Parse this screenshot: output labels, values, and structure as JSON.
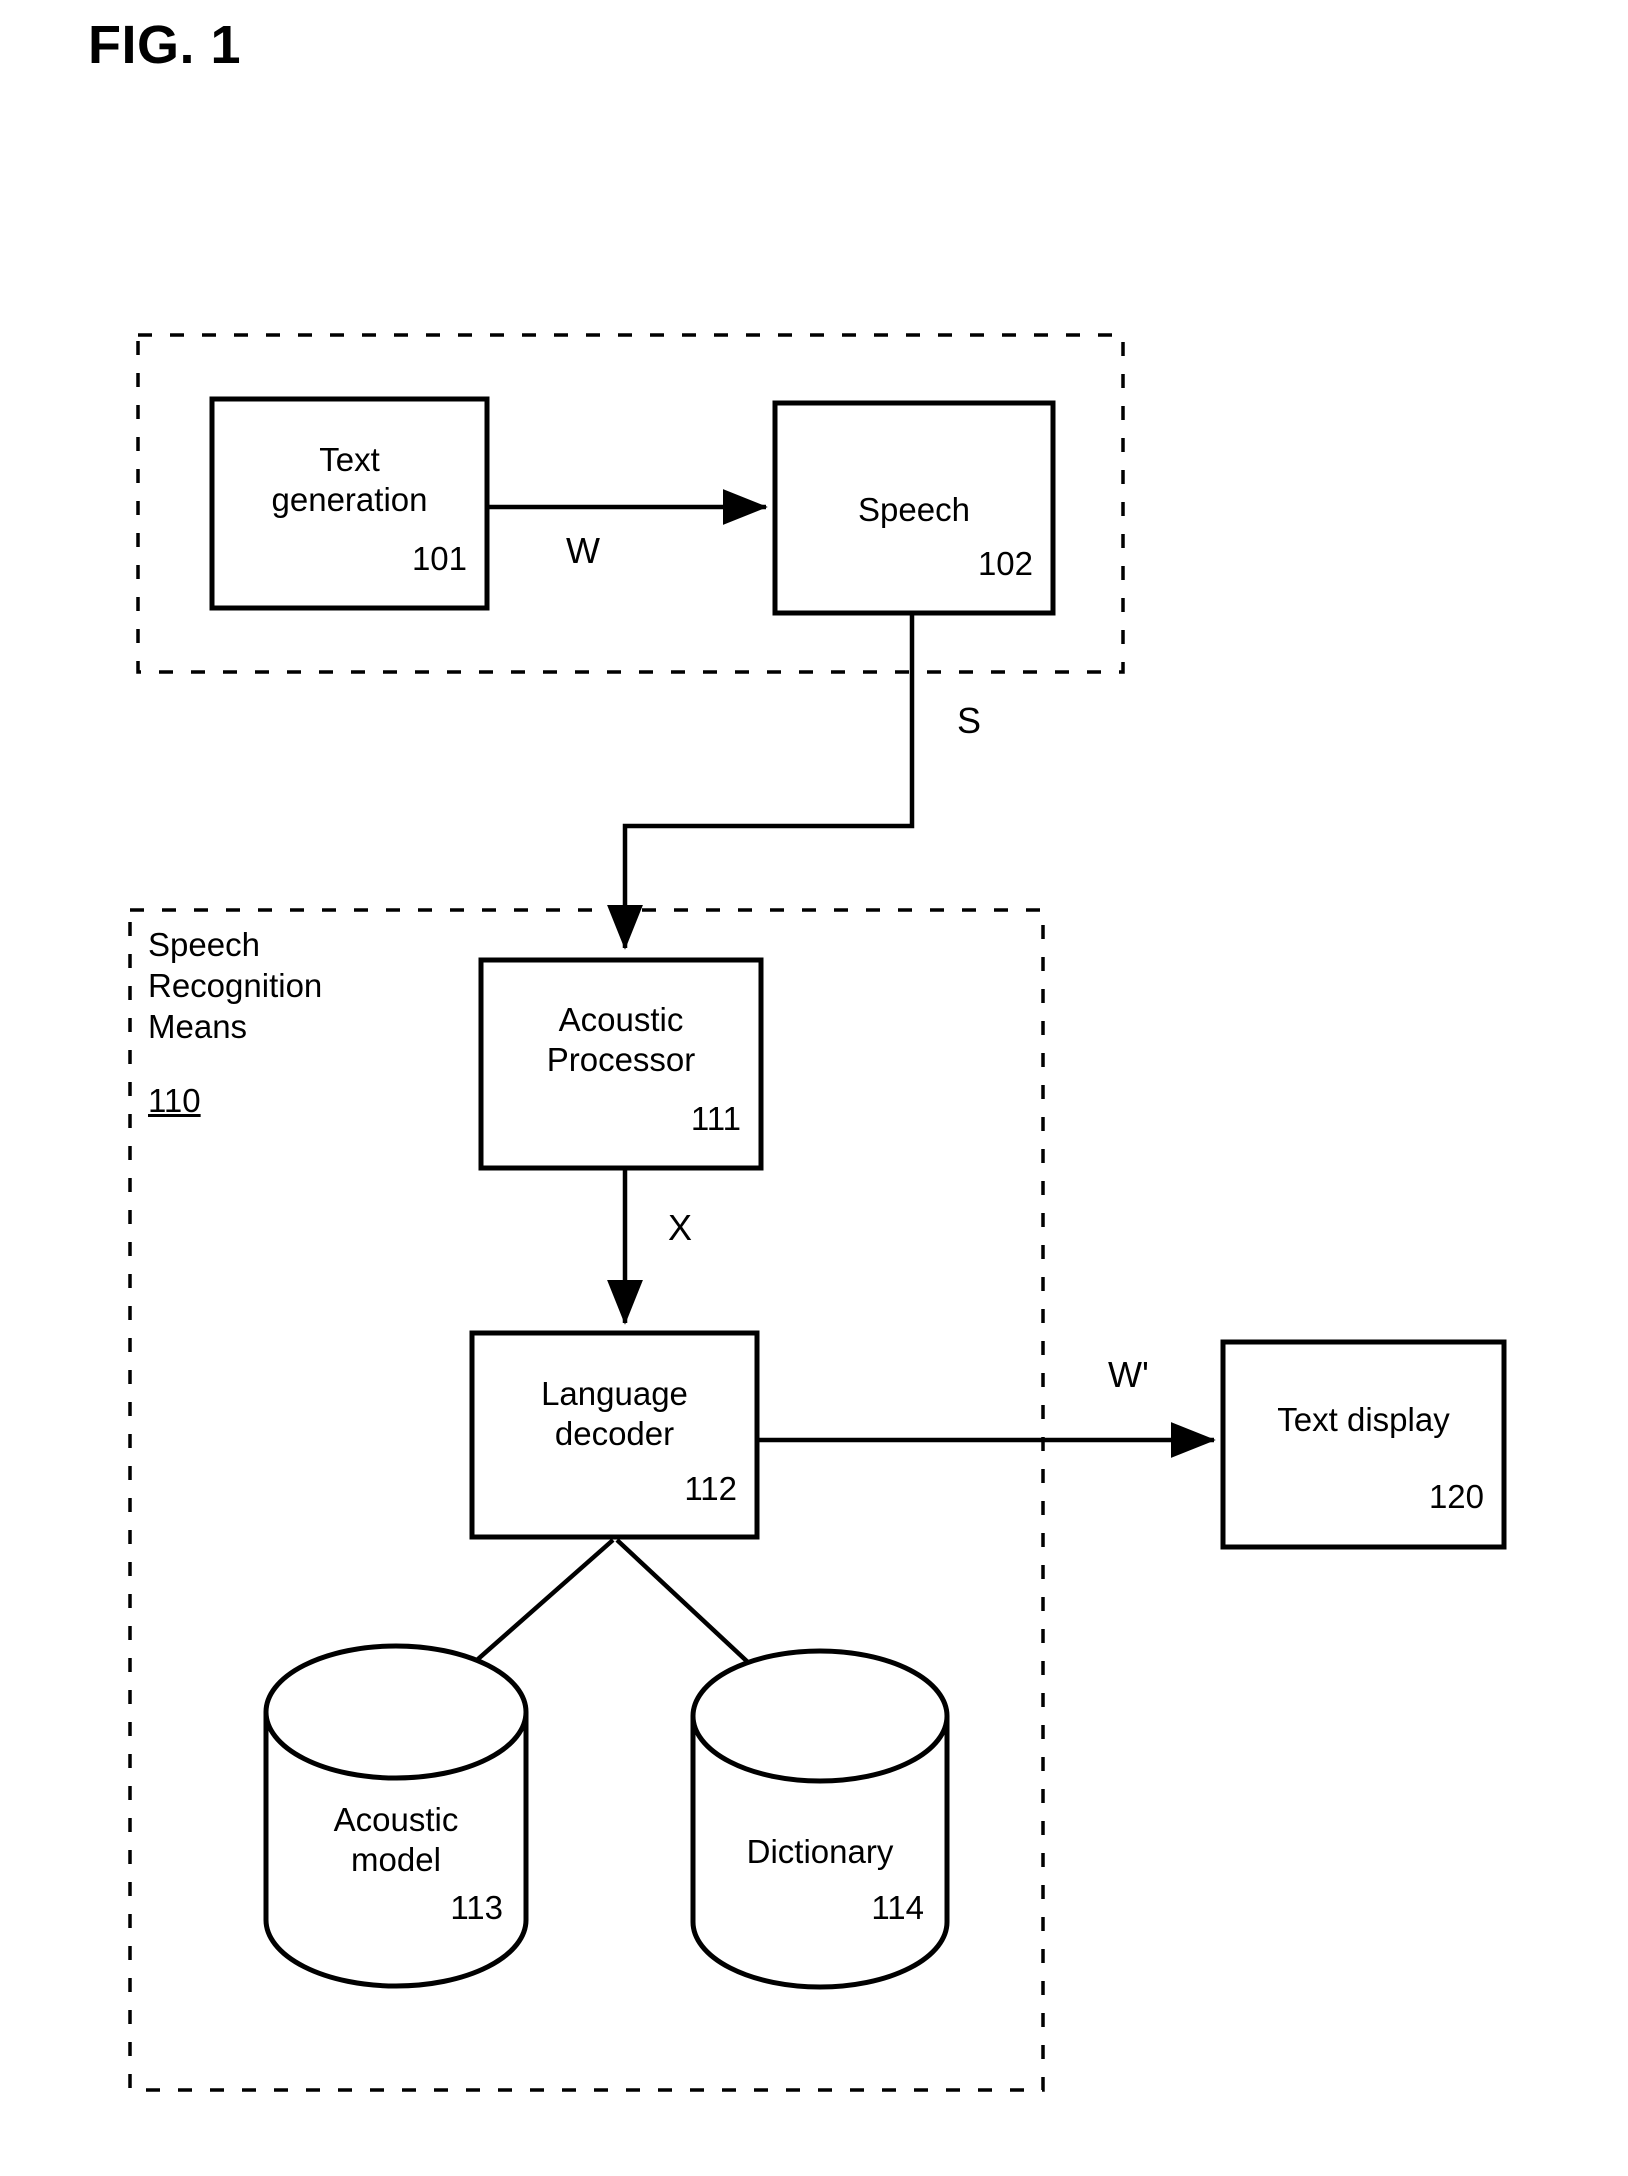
{
  "figure": {
    "title": "FIG. 1",
    "caption_number": "1"
  },
  "groups": [
    {
      "name": "text-to-speech-group",
      "label": "",
      "number": ""
    },
    {
      "name": "speech-recognition-means-group",
      "label": "Speech\nRecognition\nMeans",
      "number": "110"
    }
  ],
  "blocks": [
    {
      "name": "text-generation",
      "label": "Text\ngeneration",
      "number": "101"
    },
    {
      "name": "speech",
      "label": "Speech",
      "number": "102"
    },
    {
      "name": "acoustic-processor",
      "label": "Acoustic\nProcessor",
      "number": "111"
    },
    {
      "name": "language-decoder",
      "label": "Language\ndecoder",
      "number": "112"
    },
    {
      "name": "text-display",
      "label": "Text display",
      "number": "120"
    }
  ],
  "stores": [
    {
      "name": "acoustic-model",
      "label": "Acoustic\nmodel",
      "number": "113"
    },
    {
      "name": "dictionary",
      "label": "Dictionary",
      "number": "114"
    }
  ],
  "edge_labels": {
    "text_to_speech": "W",
    "speech_to_recognizer": "S",
    "processor_to_decoder": "X",
    "decoder_to_display": "W'"
  },
  "colors": {
    "stroke": "#000000",
    "background": "#ffffff"
  }
}
